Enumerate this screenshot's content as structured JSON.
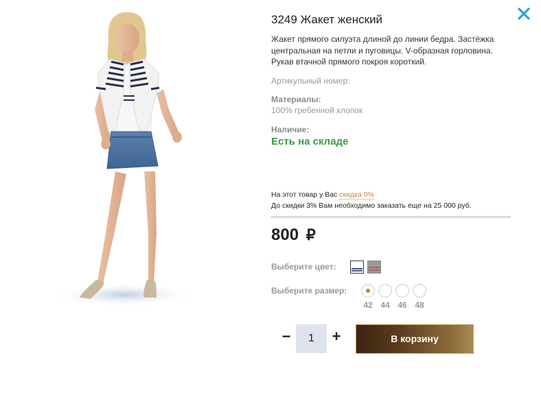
{
  "product": {
    "title": "3249 Жакет женский",
    "description": "Жакет прямого силуэта длиной до линии бедра. Застёжка центральная на петли и пуговицы. V-образная горловина. Рукав втачной прямого покроя короткий.",
    "article_label": "Артикульный номер:",
    "materials_label": "Материалы:",
    "materials_value": "100% гребенной хлопок",
    "availability_label": "Наличие:",
    "availability_value": "Есть на складе"
  },
  "discount": {
    "prefix": "На этот товар у Вас",
    "link": "скидка 0%",
    "line2": "До скидки 3% Вам необходимо заказать еще на 25 000 руб."
  },
  "price": {
    "value": "800",
    "currency": "₽"
  },
  "color": {
    "label": "Выберите цвет:",
    "options": [
      {
        "name": "white-navy-stripe",
        "bg": "#ffffff",
        "stripe": "#1a2a5a"
      },
      {
        "name": "grey-red-stripe",
        "bg": "#9a9a9a",
        "stripe": "#c0504d"
      }
    ]
  },
  "size": {
    "label": "Выберите размер:",
    "options": [
      "42",
      "44",
      "46",
      "48"
    ],
    "selected": "42"
  },
  "cart": {
    "minus": "−",
    "plus": "+",
    "quantity": "1",
    "button_label": "В корзину"
  },
  "colors": {
    "stock_green": "#3d9a4a",
    "accent_gold": "#c08a3e",
    "button_dark": "#3a2412",
    "close_blue": "#29a3d8"
  },
  "icons": {
    "close": "close-icon"
  }
}
